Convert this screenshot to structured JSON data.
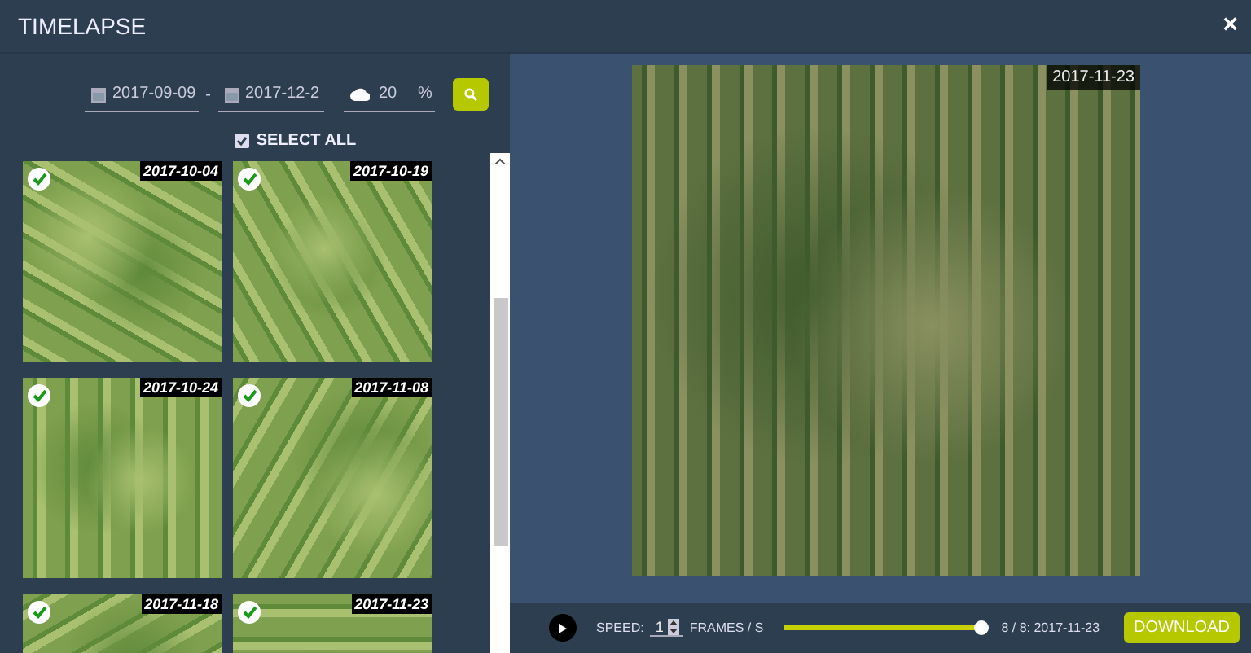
{
  "window": {
    "title": "TIMELAPSE",
    "close": "×"
  },
  "filters": {
    "date_from": "2017-09-09",
    "separator": "-",
    "date_to": "2017-12-2",
    "cloud_cover": "20",
    "cloud_unit": "%"
  },
  "select_all": {
    "label": "SELECT ALL",
    "checked": true
  },
  "thumbnails": [
    {
      "date": "2017-10-04",
      "checked": true
    },
    {
      "date": "2017-10-19",
      "checked": true
    },
    {
      "date": "2017-10-24",
      "checked": true
    },
    {
      "date": "2017-11-08",
      "checked": true
    },
    {
      "date": "2017-11-18",
      "checked": true
    },
    {
      "date": "2017-11-23",
      "checked": true
    }
  ],
  "preview": {
    "date": "2017-11-23"
  },
  "player": {
    "speed_label": "SPEED:",
    "speed": "1",
    "unit": "FRAMES / S",
    "level": 1,
    "frame": "8 / 8: 2017-11-23",
    "download": "DOWNLOAD"
  }
}
